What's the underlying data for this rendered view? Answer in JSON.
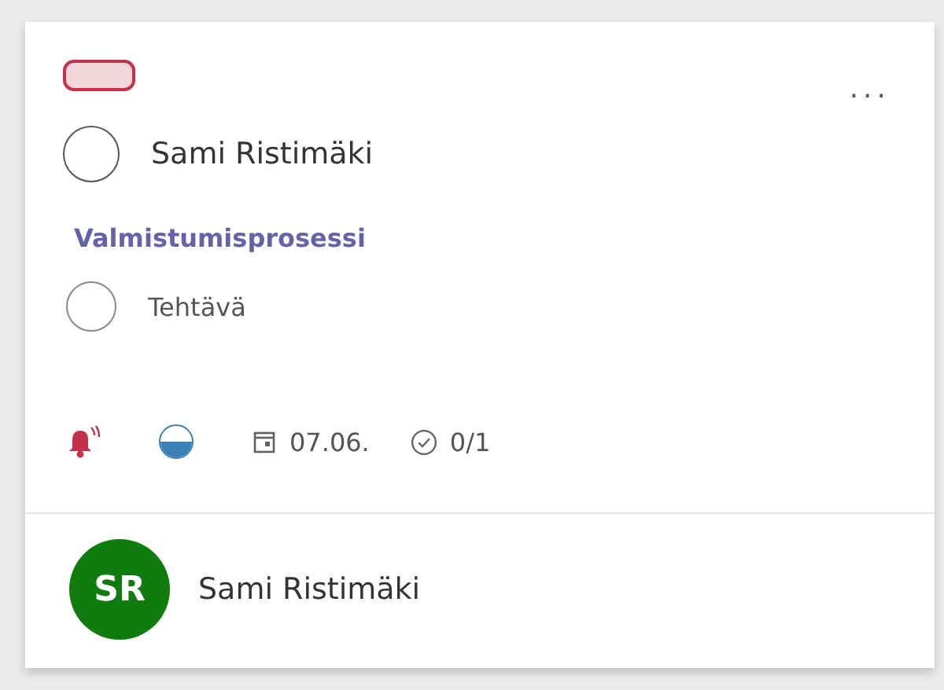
{
  "card": {
    "label": {
      "color": "#c4314b"
    },
    "task": {
      "title": "Sami Ristimäki",
      "checked": false
    },
    "more": "...",
    "plan": "Valmistumisprosessi",
    "checklist": [
      {
        "text": "Tehtävä",
        "checked": false
      }
    ],
    "footer": {
      "urgent": true,
      "in_progress": true,
      "due_date": "07.06.",
      "checklist_count": "0/1"
    },
    "assignee": {
      "initials": "SR",
      "name": "Sami Ristimäki",
      "color": "#107c10"
    }
  }
}
